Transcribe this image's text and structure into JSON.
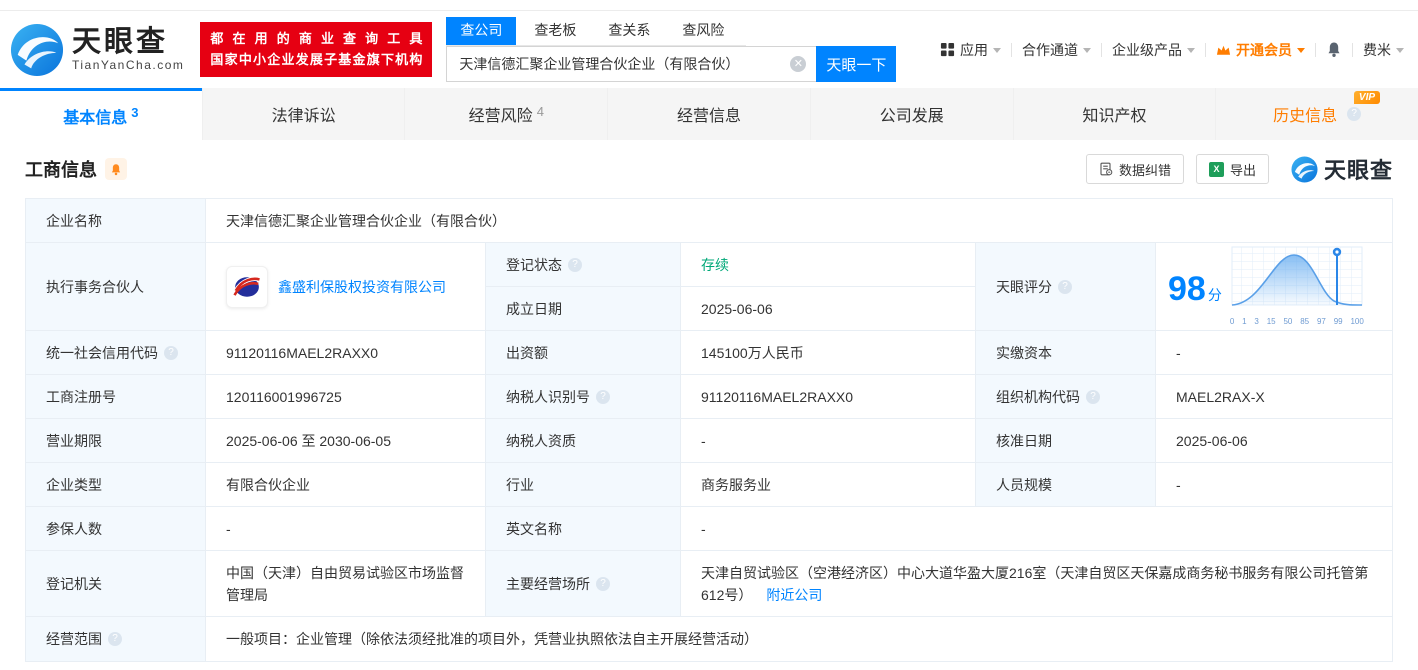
{
  "header": {
    "logo": {
      "title": "天眼查",
      "subtitle": "TianYanCha.com"
    },
    "banner": {
      "line1": "都在用的商业查询工具",
      "line2": "国家中小企业发展子基金旗下机构"
    },
    "search": {
      "tabs": [
        "查公司",
        "查老板",
        "查关系",
        "查风险"
      ],
      "value": "天津信德汇聚企业管理合伙企业（有限合伙）",
      "button": "天眼一下",
      "clear_icon": "clear-icon"
    },
    "nav": {
      "apps": "应用",
      "partner_channel": "合作通道",
      "enterprise_products": "企业级产品",
      "vip": "开通会员",
      "username": "费米"
    },
    "icons": [
      "grid-icon",
      "crown-icon",
      "bell-icon"
    ]
  },
  "tabs": [
    {
      "label": "基本信息",
      "count": "3",
      "active": true
    },
    {
      "label": "法律诉讼"
    },
    {
      "label": "经营风险",
      "count": "4"
    },
    {
      "label": "经营信息"
    },
    {
      "label": "公司发展"
    },
    {
      "label": "知识产权"
    },
    {
      "label": "历史信息",
      "badge": "VIP"
    }
  ],
  "section": {
    "title": "工商信息",
    "correct_btn": "数据纠错",
    "export_btn": "导出",
    "watermark": "天眼查"
  },
  "fields": {
    "name_label": "企业名称",
    "name": "天津信德汇聚企业管理合伙企业（有限合伙）",
    "partner_label": "执行事务合伙人",
    "partner": "鑫盛利保股权投资有限公司",
    "reg_status_label": "登记状态",
    "reg_status": "存续",
    "est_date_label": "成立日期",
    "est_date": "2025-06-06",
    "score_label": "天眼评分",
    "score": "98",
    "score_unit": "分",
    "credit_code_label": "统一社会信用代码",
    "credit_code": "91120116MAEL2RAXX0",
    "capital_label": "出资额",
    "capital": "145100万人民币",
    "paid_capital_label": "实缴资本",
    "paid_capital": "-",
    "reg_number_label": "工商注册号",
    "reg_number": "120116001996725",
    "tax_id_label": "纳税人识别号",
    "tax_id": "91120116MAEL2RAXX0",
    "org_code_label": "组织机构代码",
    "org_code": "MAEL2RAX-X",
    "business_term_label": "营业期限",
    "business_term": "2025-06-06 至 2030-06-05",
    "tax_qualification_label": "纳税人资质",
    "tax_qualification": "-",
    "approval_date_label": "核准日期",
    "approval_date": "2025-06-06",
    "company_type_label": "企业类型",
    "company_type": "有限合伙企业",
    "industry_label": "行业",
    "industry": "商务服务业",
    "staff_size_label": "人员规模",
    "staff_size": "-",
    "insured_label": "参保人数",
    "insured": "-",
    "english_name_label": "英文名称",
    "english_name": "-",
    "registry_label": "登记机关",
    "registry": "中国（天津）自由贸易试验区市场监督管理局",
    "address_label": "主要经营场所",
    "address": "天津自贸试验区（空港经济区）中心大道华盈大厦216室（天津自贸区天保嘉成商务秘书服务有限公司托管第612号）",
    "nearby_link": "附近公司",
    "scope_label": "经营范围",
    "scope": "一般项目：企业管理（除依法须经批准的项目外，凭营业执照依法自主开展经营活动）"
  },
  "score_chart": {
    "type": "area",
    "ticks": [
      "0",
      "1",
      "3",
      "15",
      "50",
      "85",
      "97",
      "99",
      "100"
    ],
    "marker_value": 98,
    "curve_color": "#5aa0e8",
    "marker_color": "#2b87e8"
  },
  "colors": {
    "primary_blue": "#0084ff",
    "banner_red": "#e60012",
    "vip_orange": "#ff7d00",
    "status_green": "#00a878",
    "label_bg": "#f3f9fe",
    "border": "#e8eef4"
  }
}
